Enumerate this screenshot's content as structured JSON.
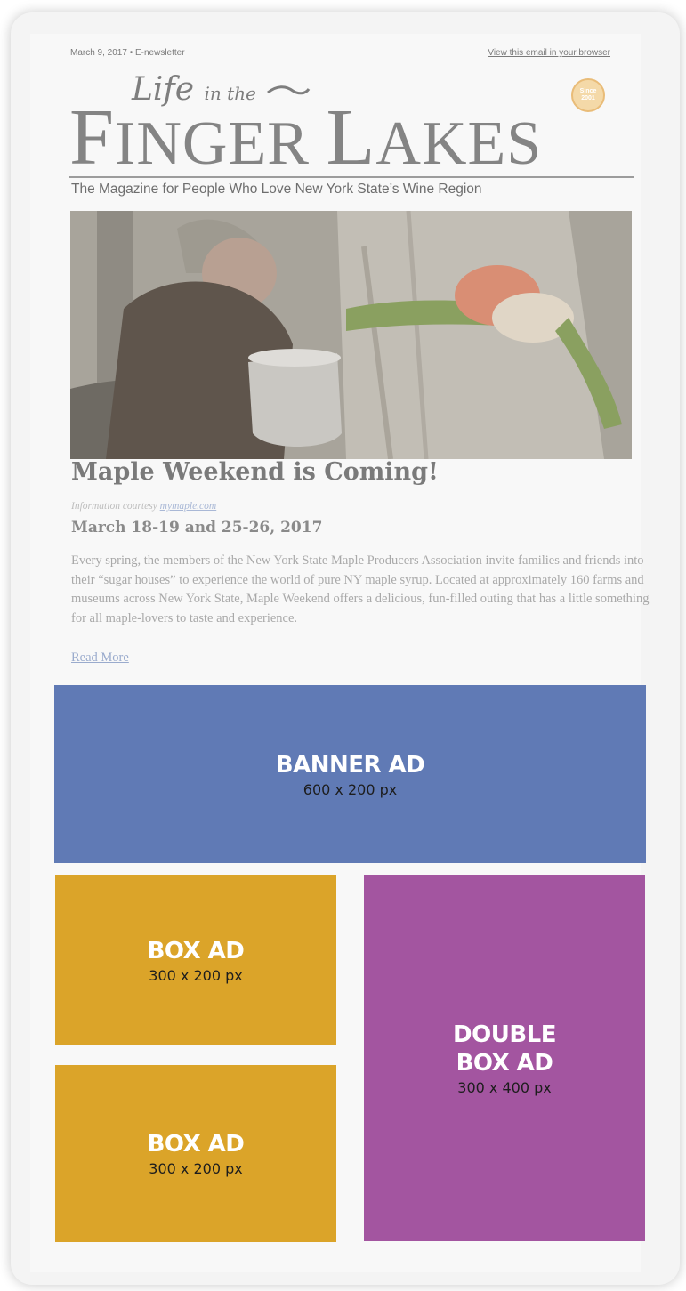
{
  "email": {
    "date_line": "March 9, 2017  •  E-newsletter",
    "view_link": "View this email in your browser"
  },
  "logo": {
    "script_text": "Life",
    "script_small": "in the",
    "main_first": "F",
    "main_rest": "INGER ",
    "main_l": "L",
    "main_end": "AKES",
    "seal_text": "Since 2001",
    "tagline": "The Magazine for People Who Love New York State’s Wine Region"
  },
  "article": {
    "headline": "Maple Weekend is Coming!",
    "credit_prefix": "Information courtesy ",
    "credit_link": "mymaple.com",
    "dates": "March 18-19 and 25-26, 2017",
    "body": "Every spring, the members of the New York State Maple Producers Association invite families and friends into their “sugar houses” to experience the world of pure NY maple syrup. Located at approximately 160 farms and museums across New York State, Maple Weekend offers a delicious, fun-filled outing that has a little something for all maple-lovers to taste and experience.",
    "read_more": "Read More"
  },
  "ads": {
    "banner": {
      "title": "BANNER AD",
      "dims": "600 x 200 px",
      "color": "#607ab5"
    },
    "box_top": {
      "title": "BOX AD",
      "dims": "300 x 200 px",
      "color": "#dba429"
    },
    "box_bottom": {
      "title": "BOX AD",
      "dims": "300 x 200 px",
      "color": "#dba429"
    },
    "double": {
      "title": "DOUBLE\nBOX AD",
      "dims": "300 x 400 px",
      "color": "#a355a0"
    }
  }
}
